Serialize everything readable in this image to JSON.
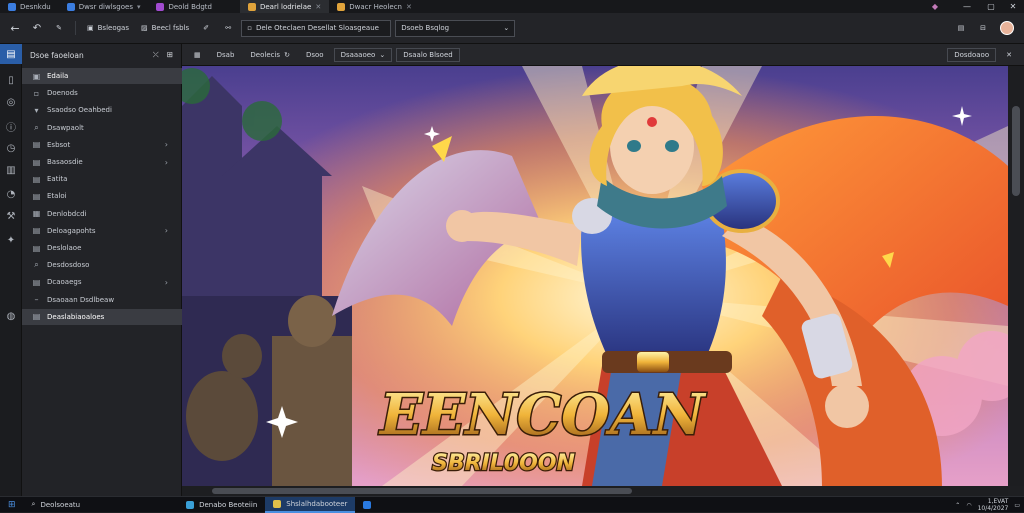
{
  "tabs": [
    {
      "label": "Desnkdu",
      "color": "#3b7de0"
    },
    {
      "label": "Dwsr diwlsgoes",
      "color": "#3b7de0"
    },
    {
      "label": "Deold Bdgtd",
      "color": "#a14bd0"
    },
    {
      "label": "Dearl lodrielae",
      "color": "#e0a33b",
      "active": true
    },
    {
      "label": "Dwacr Heolecn",
      "color": "#e0a33b"
    }
  ],
  "toolbar": {
    "btn1": "Bsleogas",
    "btn2": "Beecl fsbls",
    "address": "Dele Oteclaen Desellat Sloasgeaue",
    "search": "Dsoeb Bsqlog"
  },
  "sidebar": {
    "title": "Dsoe faoeloan",
    "items": [
      {
        "label": "Edaila",
        "icon": "folder-icon",
        "glyph": "▣",
        "selected": true
      },
      {
        "label": "Doenods",
        "icon": "file-icon",
        "glyph": "▫"
      },
      {
        "label": "Ssaodso Oeahbedi",
        "icon": "triangle-icon",
        "glyph": "▾"
      },
      {
        "label": "Dsawpaolt",
        "icon": "link-icon",
        "glyph": "⌕"
      },
      {
        "label": "Esbsot",
        "icon": "doc-icon",
        "glyph": "▤",
        "chevron": true
      },
      {
        "label": "Basaosdie",
        "icon": "doc-icon",
        "glyph": "▤",
        "chevron": true
      },
      {
        "label": "Eatita",
        "icon": "doc-icon",
        "glyph": "▤"
      },
      {
        "label": "Etaloi",
        "icon": "doc-icon",
        "glyph": "▤"
      },
      {
        "label": "Denlobdcdi",
        "icon": "grid-icon",
        "glyph": "▦"
      },
      {
        "label": "Deloagapohts",
        "icon": "doc-icon",
        "glyph": "▤",
        "chevron": true
      },
      {
        "label": "Deslolaoe",
        "icon": "doc-icon",
        "glyph": "▤"
      },
      {
        "label": "Desdosdoso",
        "icon": "link-icon",
        "glyph": "⌕"
      },
      {
        "label": "Dcaoaegs",
        "icon": "doc-icon",
        "glyph": "▤",
        "chevron": true
      },
      {
        "label": "Dsaoaan Dsdlbeaw",
        "icon": "dash-icon",
        "glyph": "–"
      },
      {
        "label": "Deaslabiaoaloes",
        "icon": "doc-icon",
        "glyph": "▤",
        "selected": true
      }
    ]
  },
  "content_toolbar": {
    "b1": "Dsab",
    "b2": "Deolecis",
    "b3": "Dsoo",
    "b4": "Dsaaaoeo",
    "b5": "Dsaalo Blsoed",
    "right": "Dosdoaoo"
  },
  "artwork": {
    "title": "EENCOAN",
    "subtitle": "SBRIL0OON"
  },
  "taskbar": {
    "search": "Deolsoeatu",
    "apps": [
      {
        "label": "Denabo Beoteiin",
        "color": "#3aa0d8"
      },
      {
        "label": "Shslalhdabooteer",
        "color": "#e0c04a",
        "active": true
      }
    ],
    "clock_time": "1,EVAT",
    "clock_date": "10/4/2027"
  }
}
